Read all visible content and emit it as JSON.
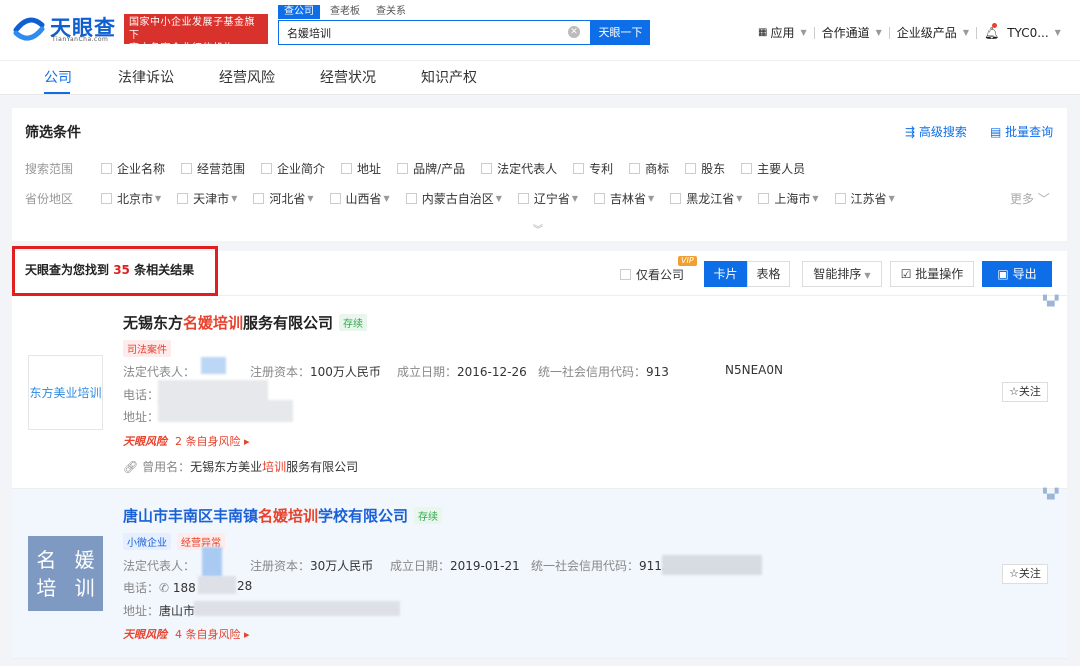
{
  "brand": {
    "title": "天眼查",
    "site": "TianYanCha.com",
    "badge_line1": "国家中小企业发展子基金旗下",
    "badge_line2": "官方备案企业征信机构"
  },
  "search": {
    "tabs": [
      "查公司",
      "查老板",
      "查关系"
    ],
    "query": "名媛培训",
    "button": "天眼一下"
  },
  "topnav": {
    "apps": "应用",
    "partner": "合作通道",
    "enterprise": "企业级产品",
    "user": "TYC0..."
  },
  "main_tabs": [
    "公司",
    "法律诉讼",
    "经营风险",
    "经营状况",
    "知识产权"
  ],
  "filter": {
    "title": "筛选条件",
    "advanced": "高级搜索",
    "batch_query": "批量查询",
    "scope_label": "搜索范围",
    "scope": [
      "企业名称",
      "经营范围",
      "企业简介",
      "地址",
      "品牌/产品",
      "法定代表人",
      "专利",
      "商标",
      "股东",
      "主要人员"
    ],
    "region_label": "省份地区",
    "regions": [
      "北京市",
      "天津市",
      "河北省",
      "山西省",
      "内蒙古自治区",
      "辽宁省",
      "吉林省",
      "黑龙江省",
      "上海市",
      "江苏省"
    ],
    "more": "更多"
  },
  "results": {
    "prefix": "天眼查为您找到",
    "count": "35",
    "suffix": "条相关结果",
    "only_company": "仅看公司",
    "vip": "VIP",
    "view_card": "卡片",
    "view_table": "表格",
    "sort": "智能排序",
    "batch_op": "批量操作",
    "export": "导出"
  },
  "companies": [
    {
      "logo_text": "东方美业培训",
      "name_pre": "无锡东方",
      "name_hl": "名媛培训",
      "name_post": "服务有限公司",
      "status": "存续",
      "tags": [
        "司法案件"
      ],
      "legal_label": "法定代表人：",
      "capital_label": "注册资本：",
      "capital": "100万人民币",
      "date_label": "成立日期：",
      "date": "2016-12-26",
      "credit_label": "统一社会信用代码：",
      "credit_a": "913",
      "credit_b": "N5NEA0N",
      "phone_label": "电话：",
      "address_label": "地址：",
      "risk_brand": "天眼风险",
      "risk_count": "2 条自身风险 ▸",
      "former_label": "曾用名：",
      "former_pre": "无锡东方美业",
      "former_hl": "培训",
      "former_post": "服务有限公司",
      "follow": "☆关注"
    },
    {
      "logo_line1": "名 媛",
      "logo_line2": "培 训",
      "name_pre": "唐山市丰南区丰南镇",
      "name_hl": "名媛培训",
      "name_post": "学校有限公司",
      "status": "存续",
      "tags": [
        "小微企业",
        "经营异常"
      ],
      "legal_label": "法定代表人：",
      "capital_label": "注册资本：",
      "capital": "30万人民币",
      "date_label": "成立日期：",
      "date": "2019-01-21",
      "credit_label": "统一社会信用代码：",
      "credit_a": "9113",
      "phone_label": "电话：",
      "phone_a": "188",
      "phone_b": "28",
      "address_label": "地址：",
      "address_a": "唐山市",
      "risk_brand": "天眼风险",
      "risk_count": "4 条自身风险 ▸",
      "follow": "☆关注"
    }
  ]
}
